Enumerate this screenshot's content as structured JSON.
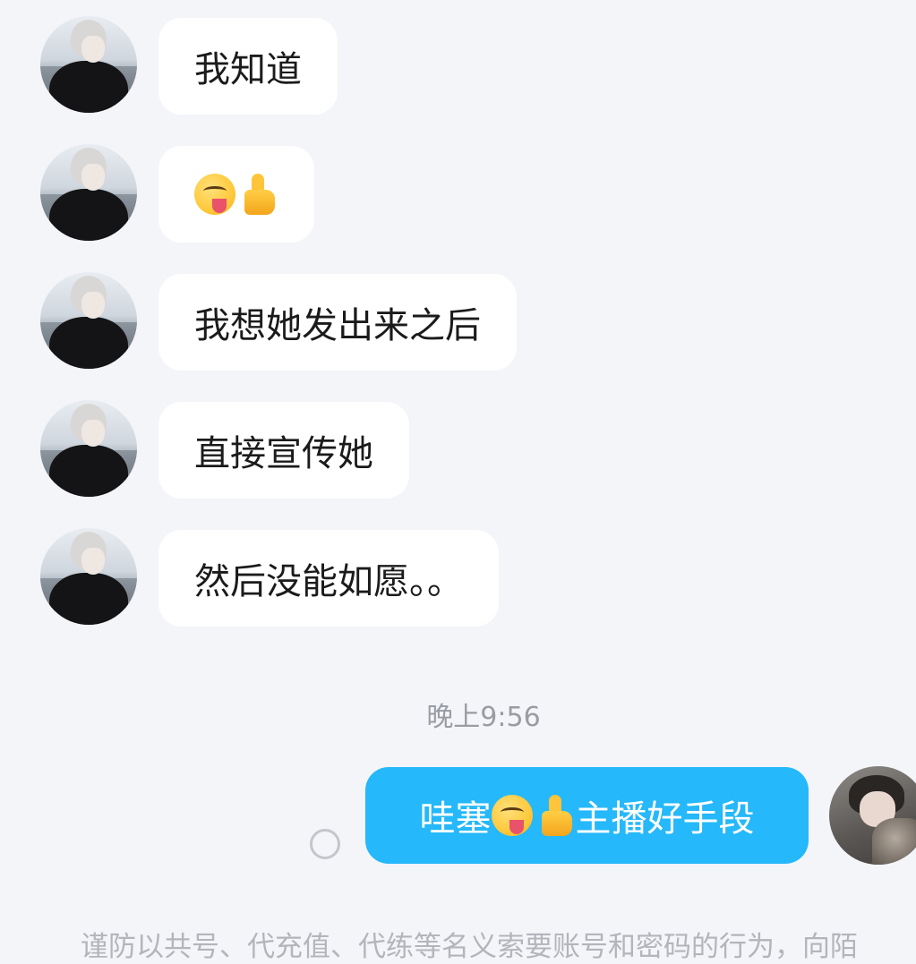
{
  "messages_received": [
    {
      "text": "我知道"
    },
    {
      "emojis": [
        "yum-face-emoji",
        "thumbs-up-emoji"
      ]
    },
    {
      "text": "我想她发出来之后"
    },
    {
      "text": "直接宣传她"
    },
    {
      "text": "然后没能如愿。。"
    }
  ],
  "timestamp": "晚上9:56",
  "message_sent": {
    "text_before": "哇塞",
    "emojis": [
      "yum-face-emoji",
      "thumbs-up-emoji"
    ],
    "text_after": "主播好手段"
  },
  "footer_notice": "谨防以共号、代充值、代练等名义索要账号和密码的行为，向陌",
  "colors": {
    "background": "#f4f5f9",
    "received_bubble": "#ffffff",
    "sent_bubble": "#25b8fa",
    "timestamp_text": "#9a9ca3"
  }
}
